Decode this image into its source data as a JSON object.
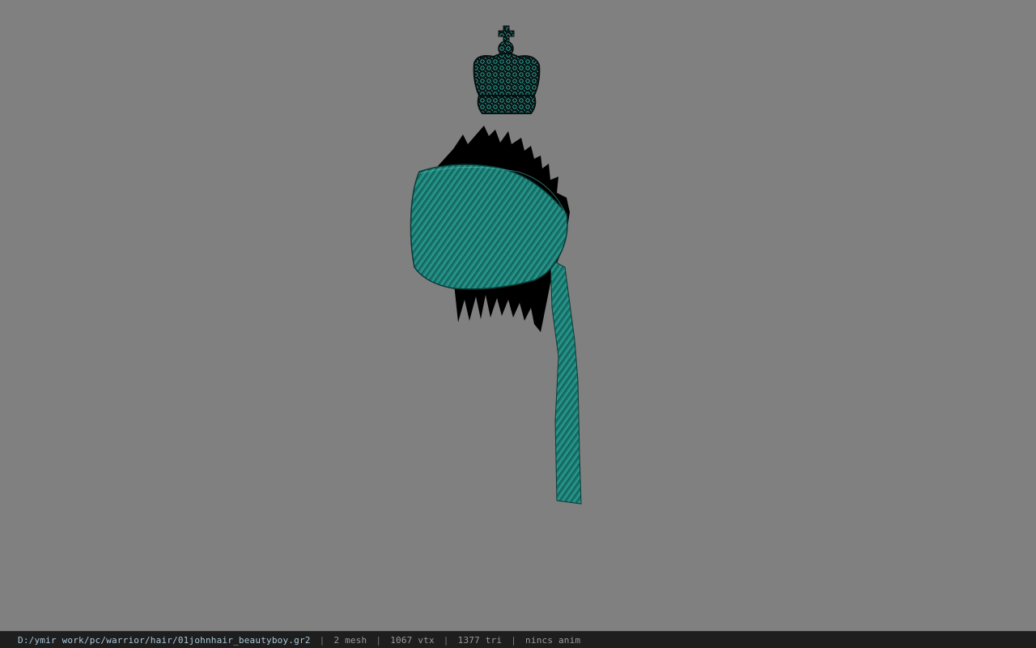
{
  "status_bar": {
    "file_path": "D:/ymir work/pc/warrior/hair/01johnhair_beautyboy.gr2",
    "mesh_count": "2 mesh",
    "vertex_count": "1067 vtx",
    "triangle_count": "1377 tri",
    "animation": "nincs anim",
    "separator": "|"
  },
  "colors": {
    "background": "#808080",
    "teal": "#1f8f84",
    "status_bg": "#1e1e1e"
  },
  "model": {
    "icons": [
      "crown-icon",
      "bandana-hair-mesh"
    ]
  }
}
